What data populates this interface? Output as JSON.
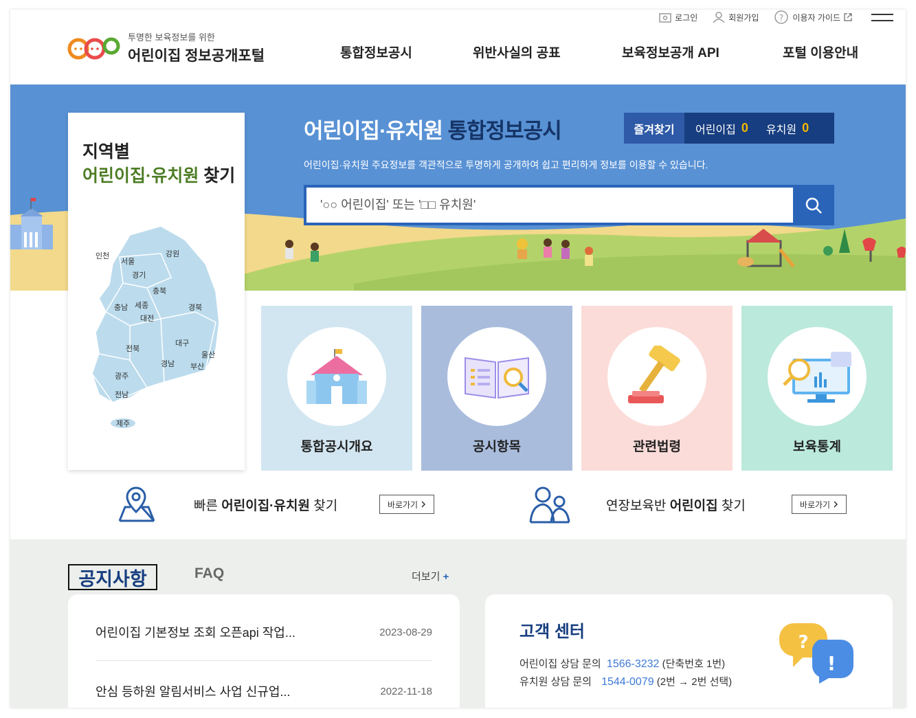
{
  "header": {
    "logo_sub": "투명한 보육정보를 위한",
    "logo_main": "어린이집 정보공개포털",
    "top_links": [
      "로그인",
      "회원가입",
      "이용자 가이드"
    ],
    "nav": [
      "통합정보공시",
      "위반사실의 공표",
      "보육정보공개 API",
      "포털 이용안내"
    ]
  },
  "map": {
    "title_line1": "지역별",
    "title_green": "어린이집·유치원",
    "title_rest": "찾기",
    "regions": [
      "인천",
      "서울",
      "강원",
      "경기",
      "충북",
      "충남",
      "세종",
      "경북",
      "대전",
      "대구",
      "전북",
      "울산",
      "경남",
      "부산",
      "광주",
      "전남",
      "제주"
    ]
  },
  "hero": {
    "title_white": "어린이집·유치원",
    "title_dark": "통합정보공시",
    "description": "어린이집·유치원 주요정보를 객관적으로 투명하게 공개하여 쉽고 편리하게 정보를 이용할 수 있습니다.",
    "search_placeholder": "'○○ 어린이집' 또는 '□□ 유치원'",
    "favorites": {
      "label": "즐겨찾기",
      "daycare_label": "어린이집",
      "daycare_count": "0",
      "kinder_label": "유치원",
      "kinder_count": "0"
    }
  },
  "tiles": [
    {
      "label": "통합공시개요",
      "bg": "#d2e6f1"
    },
    {
      "label": "공시항목",
      "bg": "#a9bcdc"
    },
    {
      "label": "관련법령",
      "bg": "#fbdcd9"
    },
    {
      "label": "보육통계",
      "bg": "#bbe9dc"
    }
  ],
  "quick": [
    {
      "pre": "빠른 ",
      "bold": "어린이집·유치원",
      "post": " 찾기",
      "button": "바로가기"
    },
    {
      "pre": "연장보육반 ",
      "bold": "어린이집",
      "post": " 찾기",
      "button": "바로가기"
    }
  ],
  "notice": {
    "tab_notice": "공지사항",
    "tab_faq": "FAQ",
    "more": "더보기",
    "items": [
      {
        "title": "어린이집 기본정보 조회 오픈api 작업...",
        "date": "2023-08-29"
      },
      {
        "title": "안심 등하원 알림서비스 사업 신규업...",
        "date": "2022-11-18"
      }
    ]
  },
  "customer_center": {
    "title": "고객 센터",
    "lines": [
      {
        "label": "어린이집 상담 문의",
        "number": "1566-3232",
        "note": "(단축번호 1번)"
      },
      {
        "label": "유치원 상담 문의",
        "number": "1544-0079",
        "note": "(2번 → 2번 선택)"
      }
    ]
  },
  "colors": {
    "primary": "#2a64b8",
    "navy": "#173e80",
    "sky": "#5891d4",
    "accent_yellow": "#f5b800",
    "map_green": "#4c7c23"
  }
}
